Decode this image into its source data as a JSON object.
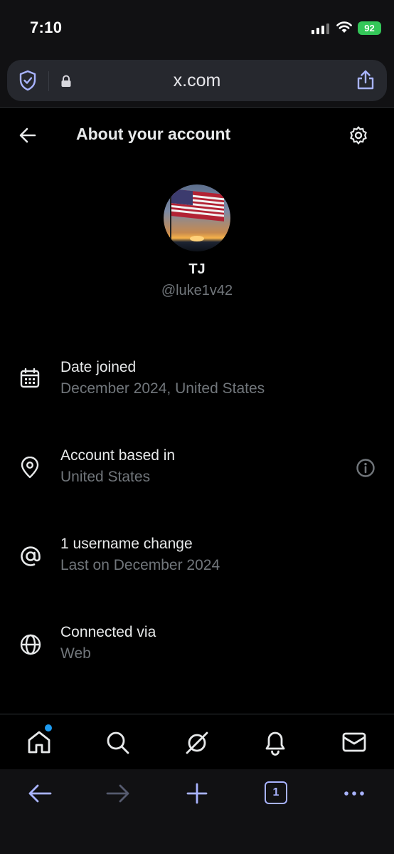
{
  "status_bar": {
    "time": "7:10",
    "battery": "92"
  },
  "browser": {
    "url": "x.com",
    "tab_count": "1"
  },
  "header": {
    "title": "About your account"
  },
  "profile": {
    "name": "TJ",
    "handle": "@luke1v42"
  },
  "rows": [
    {
      "icon": "calendar-icon",
      "title": "Date joined",
      "subtitle": "December 2024, United States"
    },
    {
      "icon": "location-pin-icon",
      "title": "Account based in",
      "subtitle": "United States"
    },
    {
      "icon": "at-sign-icon",
      "title": "1 username change",
      "subtitle": "Last on December 2024"
    },
    {
      "icon": "globe-icon",
      "title": "Connected via",
      "subtitle": "Web"
    }
  ],
  "tabbar": [
    "home-icon",
    "search-icon",
    "grok-icon",
    "bell-icon",
    "mail-icon"
  ],
  "colors": {
    "accent": "#1d9bf0",
    "browser_accent": "#a8b3ff",
    "battery": "#34c759",
    "muted_text": "#71767b"
  }
}
